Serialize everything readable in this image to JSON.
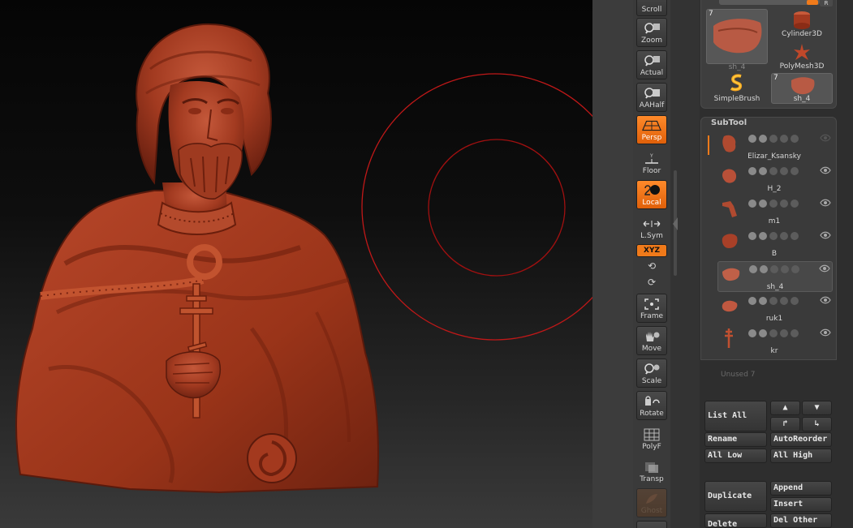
{
  "shelf": {
    "scroll": "Scroll",
    "zoom": "Zoom",
    "actual": "Actual",
    "aahalf": "AAHalf",
    "persp": "Persp",
    "floor": "Floor",
    "local": "Local",
    "lsym": "L.Sym",
    "xyz": "XYZ",
    "frame": "Frame",
    "move": "Move",
    "scale": "Scale",
    "rotate": "Rotate",
    "polyf": "PolyF",
    "transp": "Transp",
    "ghost": "Ghost"
  },
  "tool_panel": {
    "r_button": "R",
    "current_tool": {
      "name": "sh_4",
      "count": "7"
    },
    "tools": [
      {
        "name": "Cylinder3D"
      },
      {
        "name": "PolyMesh3D"
      },
      {
        "name": "SimpleBrush"
      },
      {
        "name": "sh_4",
        "count": "7"
      }
    ]
  },
  "subtool": {
    "title": "SubTool",
    "items": [
      {
        "name": "Elizar_Ksansky",
        "selected": false
      },
      {
        "name": "H_2",
        "selected": false
      },
      {
        "name": "m1",
        "selected": false
      },
      {
        "name": "B",
        "selected": false
      },
      {
        "name": "sh_4",
        "selected": true
      },
      {
        "name": "ruk1",
        "selected": false
      },
      {
        "name": "kr",
        "selected": false
      }
    ],
    "unused": "Unused 7"
  },
  "subtool_buttons": {
    "list_all": "List All",
    "rename": "Rename",
    "autoreorder": "AutoReorder",
    "all_low": "All Low",
    "all_high": "All High",
    "duplicate": "Duplicate",
    "append": "Append",
    "insert": "Insert",
    "delete": "Delete",
    "del_other": "Del Other"
  },
  "colors": {
    "accent": "#f07a1a",
    "sculpt": "#a8391f",
    "brush_ring": "#c01818"
  }
}
